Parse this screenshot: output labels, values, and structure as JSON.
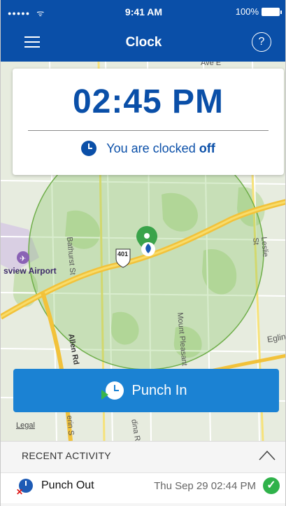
{
  "status_bar": {
    "signal": "●●●●●",
    "wifi": "ᯤ",
    "time": "9:41 AM",
    "battery": "100%"
  },
  "nav": {
    "title": "Clock",
    "help": "?"
  },
  "clock_card": {
    "time": "02:45 PM",
    "status_prefix": "You are clocked ",
    "status_value": "off"
  },
  "map": {
    "labels": {
      "airport": "sview Airport",
      "bathurst": "Bathurst St",
      "leslie": "Leslie St",
      "mount_pleasant": "Mount Pleasant",
      "allen": "Allen Rd",
      "eglinton": "Eglin",
      "avenue": "Ave E",
      "highway": "401",
      "bottom1": "erin S",
      "bottom2": "dina R"
    },
    "legal": "Legal"
  },
  "punch_button": {
    "label": "Punch In"
  },
  "recent_activity": {
    "title": "RECENT ACTIVITY",
    "items": [
      {
        "label": "Punch Out",
        "time": "Thu Sep 29 02:44 PM"
      }
    ]
  },
  "colors": {
    "brand_blue": "#0a4fa8",
    "button_blue": "#1b82d3",
    "success_green": "#2fb24a",
    "pin_green": "#3aa34a"
  }
}
